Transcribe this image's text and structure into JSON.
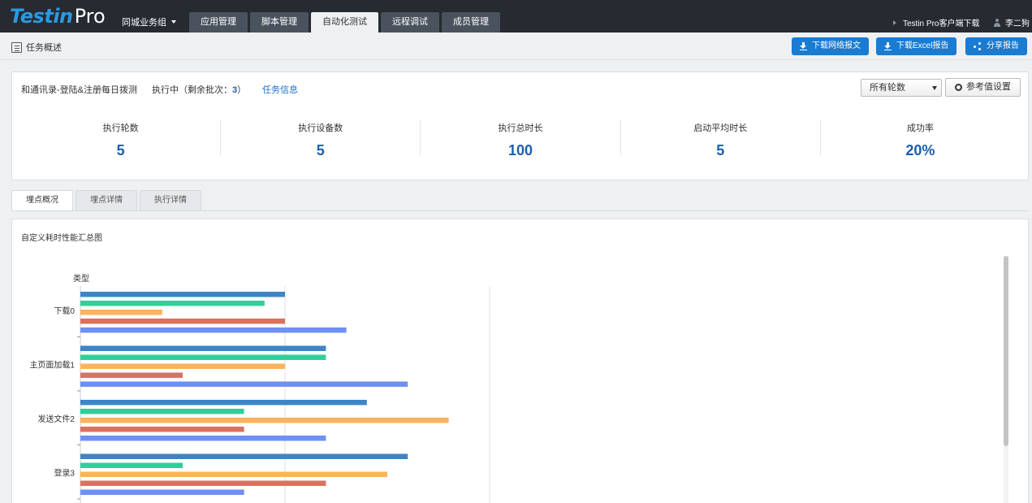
{
  "header": {
    "logo_part1": "Testin",
    "logo_part2": "Pro",
    "group": "同城业务组",
    "tabs": [
      {
        "label": "应用管理",
        "active": false
      },
      {
        "label": "脚本管理",
        "active": false
      },
      {
        "label": "自动化测试",
        "active": true
      },
      {
        "label": "远程调试",
        "active": false
      },
      {
        "label": "成员管理",
        "active": false
      }
    ],
    "client_download": "Testin Pro客户端下载",
    "user": "李二狗"
  },
  "subheader": {
    "title": "任务概述",
    "buttons": [
      "下载网络报文",
      "下载Excel报告",
      "分享报告"
    ]
  },
  "summary": {
    "task_name": "和通讯录-登陆&注册每日拨测",
    "status_prefix": "执行中（剩余批次：",
    "remaining": "3",
    "status_suffix": "）",
    "task_info_link": "任务信息",
    "round_select": "所有轮数",
    "ref_button": "参考值设置",
    "stats": [
      {
        "label": "执行轮数",
        "value": "5"
      },
      {
        "label": "执行设备数",
        "value": "5"
      },
      {
        "label": "执行总时长",
        "value": "100"
      },
      {
        "label": "启动平均时长",
        "value": "5"
      },
      {
        "label": "成功率",
        "value": "20%"
      }
    ]
  },
  "subtabs": [
    {
      "label": "埋点概况",
      "active": true
    },
    {
      "label": "埋点详情",
      "active": false
    },
    {
      "label": "执行详情",
      "active": false
    }
  ],
  "colors": {
    "topbar": "#262a31",
    "accent": "#1a7bd0",
    "stat_value": "#1a5fb0"
  },
  "chart_data": {
    "type": "bar",
    "orientation": "horizontal",
    "title": "自定义耗时性能汇总图",
    "ylabel": "类型",
    "xlabel": "",
    "xlim": [
      0,
      10
    ],
    "grid": true,
    "categories": [
      "下载0",
      "主页面加载1",
      "发送文件2",
      "登录3"
    ],
    "series": [
      {
        "color": "#3d85c6",
        "values": [
          5,
          6,
          7,
          8
        ]
      },
      {
        "color": "#2dd09a",
        "values": [
          4.5,
          6,
          4,
          2.5
        ]
      },
      {
        "color": "#fbb35e",
        "values": [
          2,
          5,
          9,
          7.5
        ]
      },
      {
        "color": "#d9725f",
        "values": [
          5,
          2.5,
          4,
          6
        ]
      },
      {
        "color": "#6e8ff3",
        "values": [
          6.5,
          8,
          6,
          4
        ]
      }
    ]
  }
}
